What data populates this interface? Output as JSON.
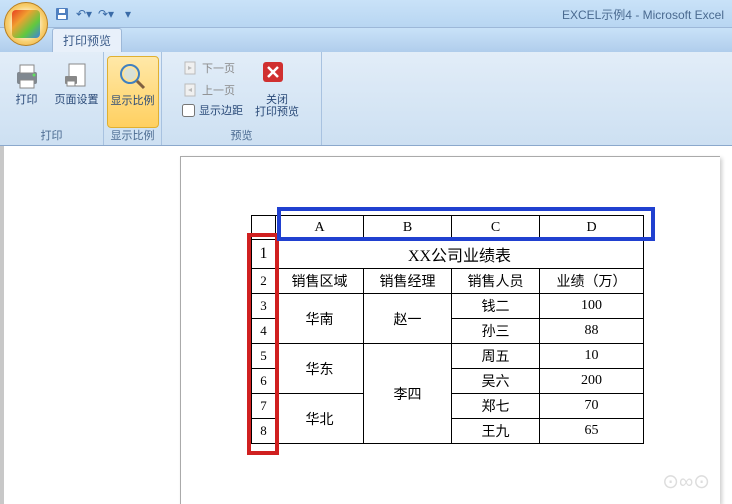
{
  "window": {
    "title": "EXCEL示例4 - Microsoft Excel"
  },
  "tabs": {
    "print_preview": "打印预览"
  },
  "ribbon": {
    "print_group": {
      "label": "打印",
      "print_btn": "打印",
      "page_setup_btn": "页面设置"
    },
    "zoom_group": {
      "label": "显示比例",
      "zoom_btn": "显示比例"
    },
    "preview_group": {
      "label": "预览",
      "next_page": "下一页",
      "prev_page": "上一页",
      "show_margins": "显示边距",
      "close_btn": "关闭\n打印预览"
    }
  },
  "chart_data": {
    "type": "table",
    "title": "XX公司业绩表",
    "column_letters": [
      "A",
      "B",
      "C",
      "D"
    ],
    "row_numbers": [
      "1",
      "2",
      "3",
      "4",
      "5",
      "6",
      "7",
      "8"
    ],
    "headers": [
      "销售区域",
      "销售经理",
      "销售人员",
      "业绩（万）"
    ],
    "rows": [
      {
        "region": "华南",
        "manager": "赵一",
        "sales": "钱二",
        "value": "100"
      },
      {
        "region": "",
        "manager": "",
        "sales": "孙三",
        "value": "88"
      },
      {
        "region": "华东",
        "manager": "",
        "sales": "周五",
        "value": "10"
      },
      {
        "region": "",
        "manager": "李四",
        "sales": "吴六",
        "value": "200"
      },
      {
        "region": "华北",
        "manager": "",
        "sales": "郑七",
        "value": "70"
      },
      {
        "region": "",
        "manager": "",
        "sales": "王九",
        "value": "65"
      }
    ]
  }
}
